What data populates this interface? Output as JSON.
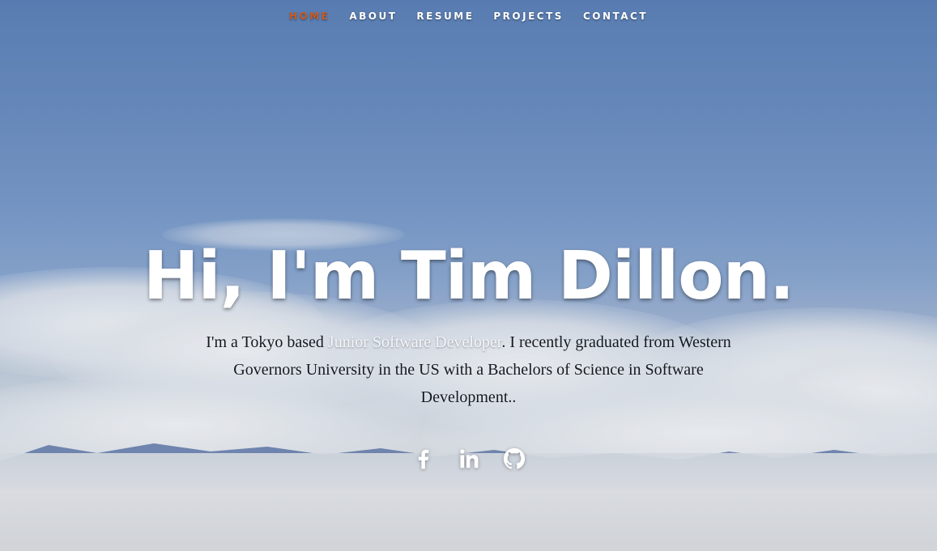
{
  "nav": {
    "items": [
      {
        "label": "HOME",
        "active": true
      },
      {
        "label": "ABOUT",
        "active": false
      },
      {
        "label": "RESUME",
        "active": false
      },
      {
        "label": "PROJECTS",
        "active": false
      },
      {
        "label": "CONTACT",
        "active": false
      }
    ],
    "active_color": "#cc5a1f"
  },
  "banner": {
    "headline": "Hi, I'm Tim Dillon.",
    "intro_before": "I'm a Tokyo based ",
    "intro_highlight": "Junior Software Developer",
    "intro_after": ". I recently graduated from Western Governors University in the US with a Bachelors of Science in Software Development.."
  },
  "social": [
    {
      "icon": "facebook-icon"
    },
    {
      "icon": "linkedin-icon"
    },
    {
      "icon": "github-icon"
    }
  ]
}
